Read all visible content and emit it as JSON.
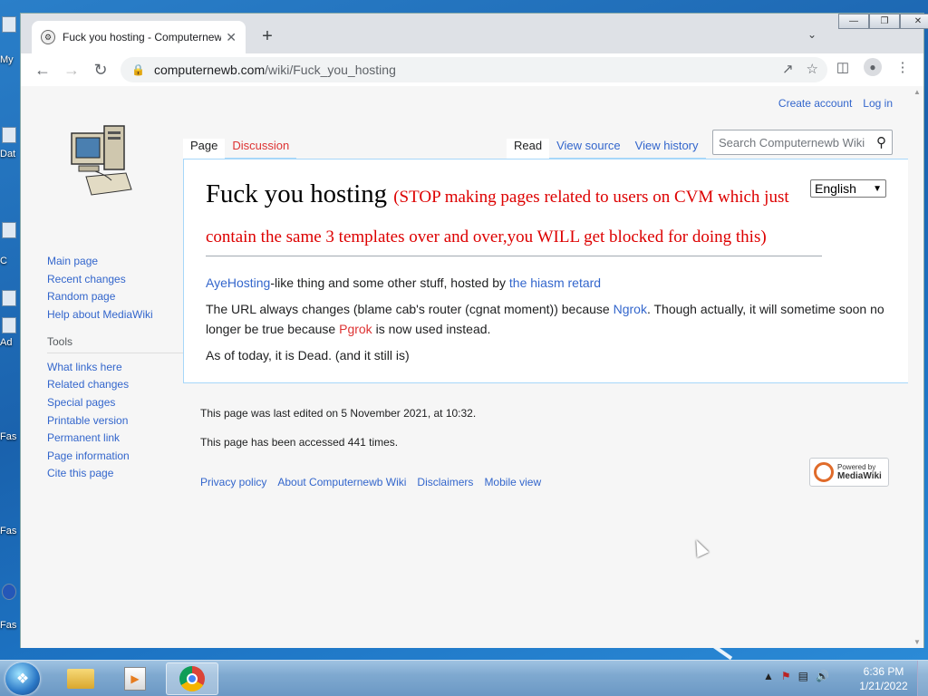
{
  "browser": {
    "tab_title": "Fuck you hosting - Computernew",
    "new_tab": "+",
    "url_host": "computernewb.com",
    "url_path": "/wiki/Fuck_you_hosting"
  },
  "personal": {
    "create_account": "Create account",
    "login": "Log in"
  },
  "page_tabs": {
    "page": "Page",
    "discussion": "Discussion",
    "read": "Read",
    "view_source": "View source",
    "view_history": "View history"
  },
  "search": {
    "placeholder": "Search Computernewb Wiki"
  },
  "sidebar": {
    "navigation": [
      {
        "label": "Main page"
      },
      {
        "label": "Recent changes"
      },
      {
        "label": "Random page"
      },
      {
        "label": "Help about MediaWiki"
      }
    ],
    "tools_heading": "Tools",
    "tools": [
      {
        "label": "What links here"
      },
      {
        "label": "Related changes"
      },
      {
        "label": "Special pages"
      },
      {
        "label": "Printable version"
      },
      {
        "label": "Permanent link"
      },
      {
        "label": "Page information"
      },
      {
        "label": "Cite this page"
      }
    ]
  },
  "article": {
    "title": "Fuck you hosting",
    "title_note": "(STOP making pages related to users on CVM which just contain the same 3 templates over and over,you WILL get blocked for doing this)",
    "language": "English",
    "p1_link1": "AyeHosting",
    "p1_text1": "-like thing and some other stuff, hosted by ",
    "p1_link2": "the hiasm retard",
    "p2_text1": "The URL always changes (blame cab's router (cgnat moment)) because ",
    "p2_link1": "Ngrok",
    "p2_text2": ". Though actually, it will sometime soon no longer be true because ",
    "p2_link2": "Pgrok",
    "p2_text3": " is now used instead.",
    "p3": "As of today, it is Dead. (and it still is)"
  },
  "footer": {
    "last_edited": "This page was last edited on 5 November 2021, at 10:32.",
    "accessed": "This page has been accessed 441 times.",
    "links": [
      {
        "label": "Privacy policy"
      },
      {
        "label": "About Computernewb Wiki"
      },
      {
        "label": "Disclaimers"
      },
      {
        "label": "Mobile view"
      }
    ],
    "powered_top": "Powered by",
    "powered_bottom": "MediaWiki"
  },
  "desktop": {
    "fragments": [
      "My",
      "Dat",
      "C",
      "Ad",
      "Fas",
      "Fas",
      "Fas"
    ]
  },
  "taskbar": {
    "time": "6:36 PM",
    "date": "1/21/2022"
  }
}
